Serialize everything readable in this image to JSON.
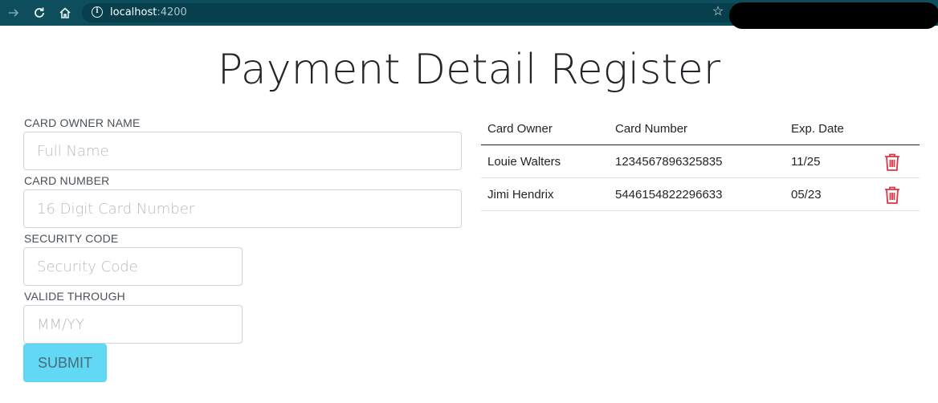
{
  "browser": {
    "url_host": "localhost",
    "url_port": ":4200",
    "icons": [
      "forward-icon",
      "reload-icon",
      "home-icon",
      "info-icon",
      "star-icon"
    ]
  },
  "page": {
    "title": "Payment Detail Register"
  },
  "form": {
    "card_owner_label": "CARD OWNER NAME",
    "card_owner_placeholder": "Full Name",
    "card_number_label": "CARD NUMBER",
    "card_number_placeholder": "16 Digit Card Number",
    "security_code_label": "SECURITY CODE",
    "security_code_placeholder": "Security Code",
    "valid_through_label": "VALIDE THROUGH",
    "valid_through_placeholder": "MM/YY",
    "submit_label": "SUBMIT"
  },
  "table": {
    "headers": [
      "Card Owner",
      "Card Number",
      "Exp. Date"
    ],
    "rows": [
      {
        "owner": "Louie Walters",
        "number": "1234567896325835",
        "exp": "11/25"
      },
      {
        "owner": "Jimi Hendrix",
        "number": "5446154822296633",
        "exp": "05/23"
      }
    ]
  },
  "colors": {
    "browser_bar": "#0e4d5c",
    "submit_button": "#61d9f5",
    "delete_icon": "#dc3545"
  }
}
